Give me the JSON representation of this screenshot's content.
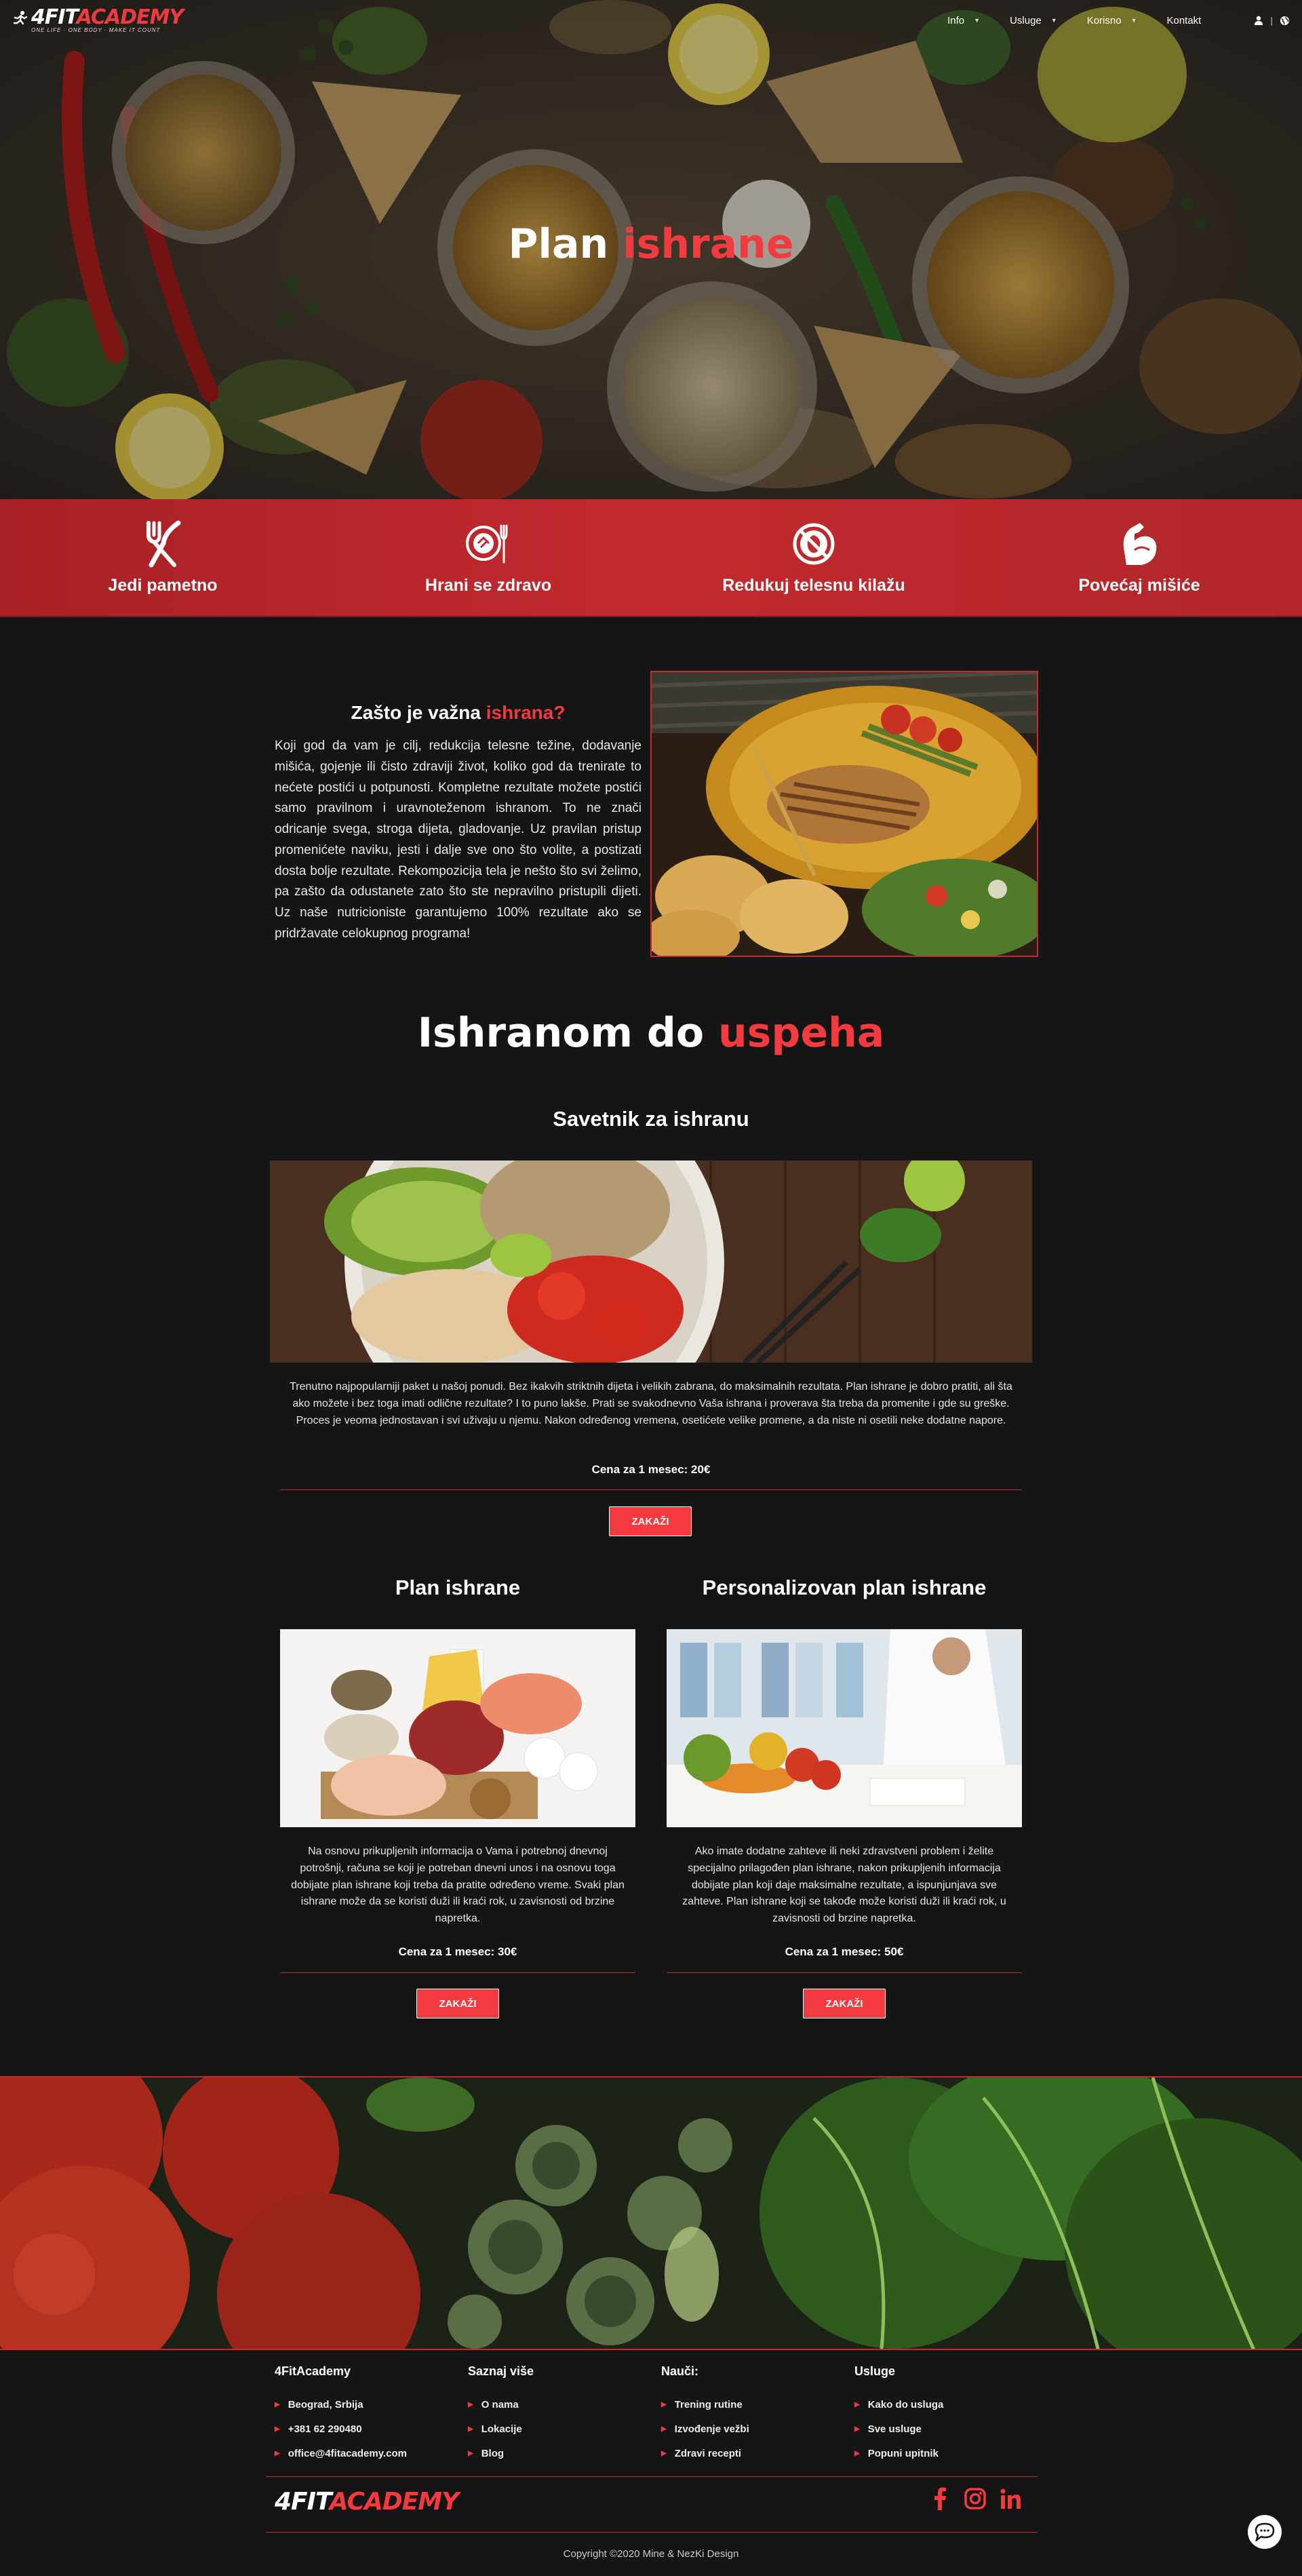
{
  "nav": {
    "logo_white": "4FIT",
    "logo_red": "ACADEMY",
    "logo_tagline": "ONE LIFE · ONE BODY · MAKE IT COUNT",
    "items": [
      {
        "label": "Info",
        "dropdown": true
      },
      {
        "label": "Usluge",
        "dropdown": true
      },
      {
        "label": "Korisno",
        "dropdown": true
      },
      {
        "label": "Kontakt",
        "dropdown": false
      }
    ],
    "icons": [
      "user-icon",
      "globe-icon"
    ],
    "separator": "|"
  },
  "hero": {
    "title_white": "Plan",
    "title_red": "ishrane"
  },
  "features": [
    {
      "label": "Jedi pametno",
      "icon": "fork-knife-icon"
    },
    {
      "label": "Hrani se zdravo",
      "icon": "plate-cutlery-icon"
    },
    {
      "label": "Redukuj telesnu kilažu",
      "icon": "no-fat-icon"
    },
    {
      "label": "Povećaj mišiće",
      "icon": "muscle-arm-icon"
    }
  ],
  "why": {
    "title_white": "Zašto je važna",
    "title_red": "ishrana?",
    "text": "Koji god da vam je cilj, redukcija telesne težine, dodavanje mišića, gojenje ili čisto zdraviji život, koliko god da trenirate to nećete postići u potpunosti. Kompletne rezultate možete postići samo pravilnom i uravnoteženom ishranom. To ne znači odricanje svega, stroga dijeta, gladovanje. Uz pravilan pristup promenićete naviku, jesti i dalje sve ono što volite, a postizati dosta bolje rezultate. Rekompozicija tela je nešto što svi želimo, pa zašto da odustanete zato što ste nepravilno pristupili dijeti. Uz naše nutricioniste garantujemo 100% rezultate ako se pridržavate celokupnog programa!"
  },
  "success": {
    "title_white": "Ishranom do",
    "title_red": "uspeha"
  },
  "cards": {
    "advisor": {
      "title": "Savetnik za ishranu",
      "desc": "Trenutno najpopularniji paket u našoj ponudi. Bez ikakvih striktnih dijeta i velikih zabrana, do maksimalnih rezultata. Plan ishrane je dobro pratiti, ali šta ako možete i bez toga imati odlične rezultate? I to puno lakše. Prati se svakodnevno Vaša ishrana i proverava šta treba da promenite i gde su greške. Proces je veoma jednostavan i svi uživaju u njemu. Nakon određenog vremena, osetićete velike promene, a da niste ni osetili neke dodatne napore.",
      "price": "Cena za 1 mesec: 20€",
      "button": "ZAKAŽI"
    },
    "plan": {
      "title": "Plan ishrane",
      "desc": "Na osnovu prikupljenih informacija o Vama i potrebnoj dnevnoj potrošnji, računa se koji je potreban dnevni unos i na osnovu toga dobijate plan ishrane koji treba da pratite određeno vreme. Svaki plan ishrane može da se koristi duži ili kraći rok, u zavisnosti od brzine napretka.",
      "price": "Cena za 1 mesec: 30€",
      "button": "ZAKAŽI"
    },
    "personal": {
      "title": "Personalizovan plan ishrane",
      "desc": "Ako imate dodatne zahteve ili neki zdravstveni problem i želite specijalno prilagođen plan ishrane, nakon prikupljenih informacija dobijate plan koji daje maksimalne rezultate, a ispunjunjava sve zahteve. Plan ishrane koji se takođe može koristi duži ili kraći rok, u zavisnosti od brzine napretka.",
      "price": "Cena za 1 mesec: 50€",
      "button": "ZAKAŽI"
    }
  },
  "footer": {
    "columns": [
      {
        "title": "4FitAcademy",
        "items": [
          "Beograd, Srbija",
          "+381 62 290480",
          "office@4fitacademy.com"
        ]
      },
      {
        "title": "Saznaj više",
        "items": [
          "O nama",
          "Lokacije",
          "Blog"
        ]
      },
      {
        "title": "Nauči:",
        "items": [
          "Trening rutine",
          "Izvođenje vežbi",
          "Zdravi recepti"
        ]
      },
      {
        "title": "Usluge",
        "items": [
          "Kako do usluga",
          "Sve usluge",
          "Popuni upitnik"
        ]
      }
    ],
    "logo_white": "4FIT",
    "logo_red": "ACADEMY",
    "social": [
      "facebook-icon",
      "instagram-icon",
      "linkedin-icon"
    ],
    "copyright": "Copyright ©2020 Mine & NezKi Design"
  },
  "colors": {
    "accent": "#f23a3f",
    "background": "#151516",
    "feature_bar": "#c22a2f"
  }
}
